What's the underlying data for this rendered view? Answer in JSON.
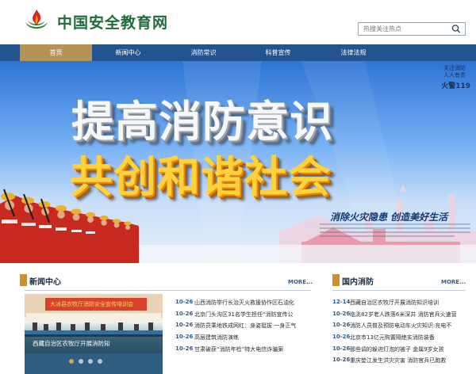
{
  "header": {
    "site_title": "中国安全教育网",
    "search_placeholder": "热搜关注热点"
  },
  "nav": {
    "items": [
      "首页",
      "新闻中心",
      "消防常识",
      "科普宣传",
      "法律法规"
    ],
    "active_index": 0
  },
  "banner": {
    "line1": "提高消防意识",
    "line2": "共创和谐社会",
    "slogan": "消除火灾隐患 创造美好生活",
    "corner_line1": "关注消防",
    "corner_line2": "人人有责",
    "corner_line3": "火警119"
  },
  "news_center": {
    "title": "新闻中心",
    "more": "MORE...",
    "photo_banner": "大冰县农牧厅消防安全宣传培训会",
    "photo_caption": "西藏自治区农牧厅开展消防知",
    "slider_total": 4,
    "slider_active": 0,
    "rows": [
      {
        "date": "10-26",
        "title": "山西消防举行长治灭火救援协作区石油化"
      },
      {
        "date": "10-26",
        "title": "北京门头沟区31名学生担任“消防宣传公"
      },
      {
        "date": "10-26",
        "title": "消防员乘地铁成网红：身姿挺拔 一身正气"
      },
      {
        "date": "10-26",
        "title": "高层建筑消防演练"
      },
      {
        "date": "10-26",
        "title": "甘肃破获“消防年检”特大电信诈骗案"
      }
    ]
  },
  "domestic": {
    "title": "国内消防",
    "more": "MORE...",
    "rows": [
      {
        "date": "12-14",
        "title": "西藏自治区农牧厅开展消防知识培训"
      },
      {
        "date": "10-26",
        "title": "临洮82岁老人跌落6米深井 消防官兵火速营"
      },
      {
        "date": "10-26",
        "title": "消防人员普及预防电动车火灾知识:充电不"
      },
      {
        "date": "10-26",
        "title": "北京市13亿元购置隔绝实消防装备"
      },
      {
        "date": "10-26",
        "title": "那些调的躲进灯泡的被子 金属9岁女孩"
      },
      {
        "date": "10-26",
        "title": "重庆垫江发生洪灾灾害 消防官兵已跑救"
      }
    ]
  },
  "colors": {
    "nav_bg": "#23548f",
    "nav_active": "#b59356",
    "title_green": "#1f6b3a",
    "section_mark": "#cf8f2e"
  }
}
